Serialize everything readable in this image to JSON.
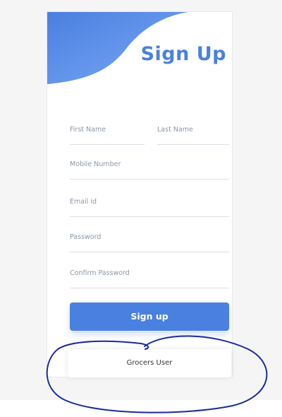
{
  "header": {
    "title": "Sign Up"
  },
  "form": {
    "first_name": "First Name",
    "last_name": "Last Name",
    "mobile": "Mobile Number",
    "email": "Email id",
    "password": "Password",
    "confirm_password": "Confirm Password"
  },
  "actions": {
    "signup_label": "Sign up"
  },
  "role_tab": {
    "label": "Grocers User"
  },
  "colors": {
    "accent": "#4a80e0",
    "annotation": "#1b2b9e"
  }
}
